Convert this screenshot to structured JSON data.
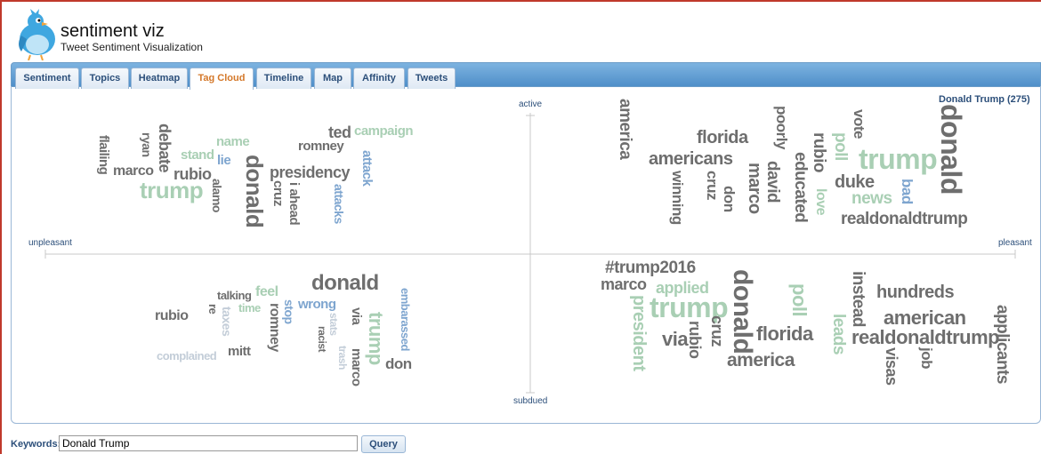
{
  "app": {
    "title": "sentiment viz",
    "subtitle": "Tweet Sentiment Visualization"
  },
  "tabs": [
    {
      "label": "Sentiment"
    },
    {
      "label": "Topics"
    },
    {
      "label": "Heatmap"
    },
    {
      "label": "Tag Cloud",
      "active": true
    },
    {
      "label": "Timeline"
    },
    {
      "label": "Map"
    },
    {
      "label": "Affinity"
    },
    {
      "label": "Tweets"
    }
  ],
  "axes": {
    "top": "active",
    "bottom": "subdued",
    "left": "unpleasant",
    "right": "pleasant"
  },
  "legend": "Donald Trump (275)",
  "query": {
    "label": "Keywords:",
    "value": "Donald Trump",
    "button": "Query"
  },
  "colors": {
    "accent_tab": "#d4782a",
    "neutral_word": "#6e6e6e",
    "pleasant_word": "#a9cfb4",
    "active_word": "#7ea5cf",
    "subdued_word": "#c3cdd8"
  },
  "words": {
    "q1": [
      "flailing",
      "ryan",
      "debate",
      "marco",
      "rubio",
      "stand",
      "lie",
      "name",
      "trump",
      "alamo",
      "donald",
      "cruz",
      "ted",
      "romney",
      "campaign",
      "presidency",
      "i ahead",
      "attack",
      "attacks"
    ],
    "q2": [
      "america",
      "florida",
      "americans",
      "winning",
      "cruz",
      "don",
      "marco",
      "david",
      "poorly",
      "educated",
      "rubio",
      "poll",
      "love",
      "vote",
      "duke",
      "trump",
      "news",
      "bad",
      "donald",
      "realdonaldtrump"
    ],
    "q3": [
      "rubio",
      "re",
      "talking",
      "taxes",
      "feel",
      "time",
      "mitt",
      "romney",
      "stop",
      "wrong",
      "donald",
      "stats",
      "racist",
      "via",
      "trump",
      "trash",
      "marco",
      "embarassed",
      "don",
      "complained"
    ],
    "q4": [
      "#trump2016",
      "marco",
      "president",
      "applied",
      "trump",
      "via",
      "rubio",
      "cruz",
      "donald",
      "poll",
      "florida",
      "america",
      "leads",
      "instead",
      "hundreds",
      "visas",
      "american",
      "realdonaldtrump",
      "job",
      "applicants"
    ]
  }
}
